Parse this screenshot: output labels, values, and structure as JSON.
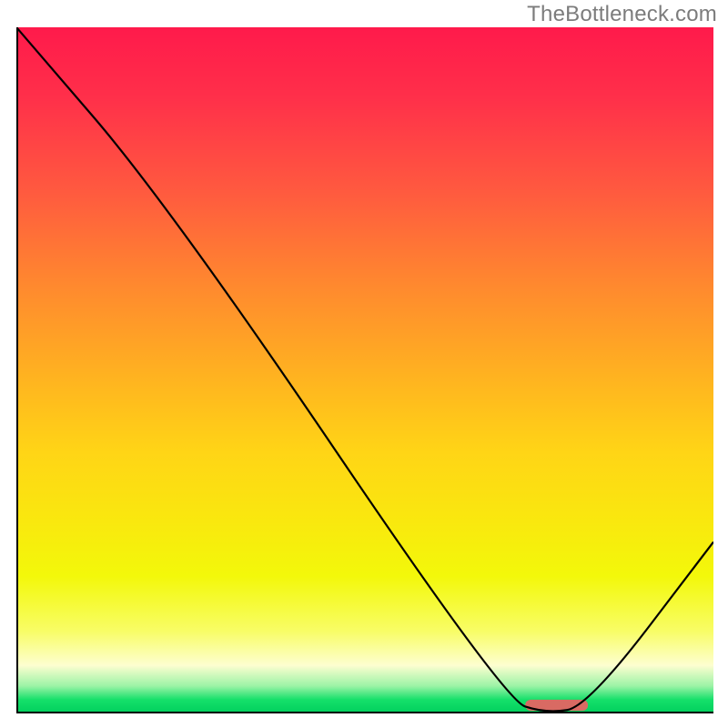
{
  "watermark": "TheBottleneck.com",
  "chart_data": {
    "type": "line",
    "title": "",
    "xlabel": "",
    "ylabel": "",
    "xlim": [
      0,
      100
    ],
    "ylim": [
      0,
      100
    ],
    "grid": false,
    "legend": false,
    "series": [
      {
        "name": "bottleneck-curve",
        "x": [
          0,
          22,
          70,
          76,
          82,
          100
        ],
        "y": [
          100,
          74,
          2,
          0,
          1,
          25
        ]
      }
    ],
    "marker": {
      "name": "optimal-range",
      "x_start": 73,
      "x_end": 82,
      "y": 1.2,
      "color": "#d96a63"
    },
    "background_gradient": {
      "orientation": "vertical",
      "stops": [
        {
          "pos": 0.0,
          "color": "#ff1a4b"
        },
        {
          "pos": 0.24,
          "color": "#ff5a3f"
        },
        {
          "pos": 0.52,
          "color": "#ffb61f"
        },
        {
          "pos": 0.8,
          "color": "#f3f80a"
        },
        {
          "pos": 0.96,
          "color": "#9cf3a6"
        },
        {
          "pos": 1.0,
          "color": "#00cf5d"
        }
      ]
    }
  }
}
